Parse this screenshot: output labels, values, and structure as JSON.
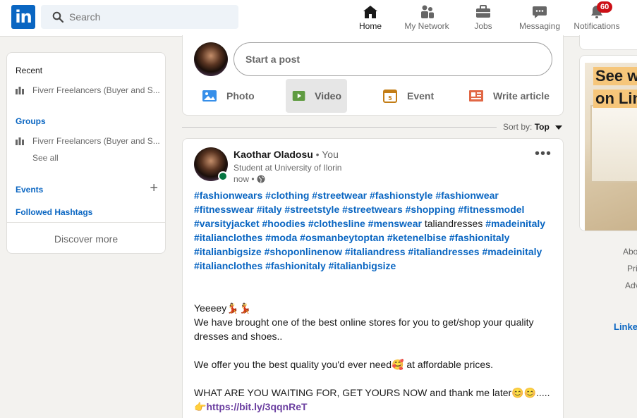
{
  "header": {
    "logo_text": "in",
    "search_placeholder": "Search",
    "nav": [
      {
        "label": "Home",
        "icon": "home-icon",
        "active": true
      },
      {
        "label": "My Network",
        "icon": "network-icon"
      },
      {
        "label": "Jobs",
        "icon": "briefcase-icon"
      },
      {
        "label": "Messaging",
        "icon": "chat-icon"
      },
      {
        "label": "Notifications",
        "icon": "bell-icon",
        "badge": "60"
      }
    ]
  },
  "sidebar": {
    "recent_title": "Recent",
    "recent_item": "Fiverr Freelancers (Buyer and S...",
    "groups_title": "Groups",
    "groups_item": "Fiverr Freelancers (Buyer and S...",
    "see_all": "See all",
    "events": "Events",
    "followed_hashtags": "Followed Hashtags",
    "discover_more": "Discover more"
  },
  "share": {
    "start_post": "Start a post",
    "photo": "Photo",
    "video": "Video",
    "event": "Event",
    "write_article": "Write article"
  },
  "feed": {
    "sort_label": "Sort by:",
    "sort_value": "Top"
  },
  "post": {
    "author": "Kaothar Oladosu",
    "you": " • You",
    "headline": "Student at University of Ilorin",
    "time": "now •",
    "hashtags_1": "#fashionwears #clothing #streetwear #fashionstyle #fashionwear #fitnesswear #italy #streetstyle #streetwears #shopping #fitnessmodel #varsityjacket #hoodies #clothesline #menswear ",
    "plain_word": "taliandresses",
    "hashtags_2": " #madeinitaly #italianclothes #moda #osmanbeytoptan #ketenelbise #fashionitaly #italianbigsize #shoponlinenow #italiandress #italiandresses #madeinitaly #italianclothes #fashionitaly #italianbigsize",
    "line_1": "Yeeeey💃💃",
    "line_2": "We have brought one of the best online stores for you to get/shop your quality dresses and shoes..",
    "line_3": "We offer you the best quality you'd ever need🥰 at affordable prices.",
    "line_4": "WHAT ARE YOU WAITING FOR, GET YOURS NOW and thank me later😊😊.....",
    "link_prefix": "👉",
    "link": "https://bit.ly/3qqnReT"
  },
  "right": {
    "ad_line_1": "See w",
    "ad_line_2": "on Lin",
    "links": [
      "Abo",
      "Pri",
      "Adv"
    ],
    "brand": "Linke"
  },
  "colors": {
    "brand_blue": "#0a66c2",
    "background": "#f3f2ef",
    "badge_red": "#cc1016",
    "online_green": "#057642"
  }
}
